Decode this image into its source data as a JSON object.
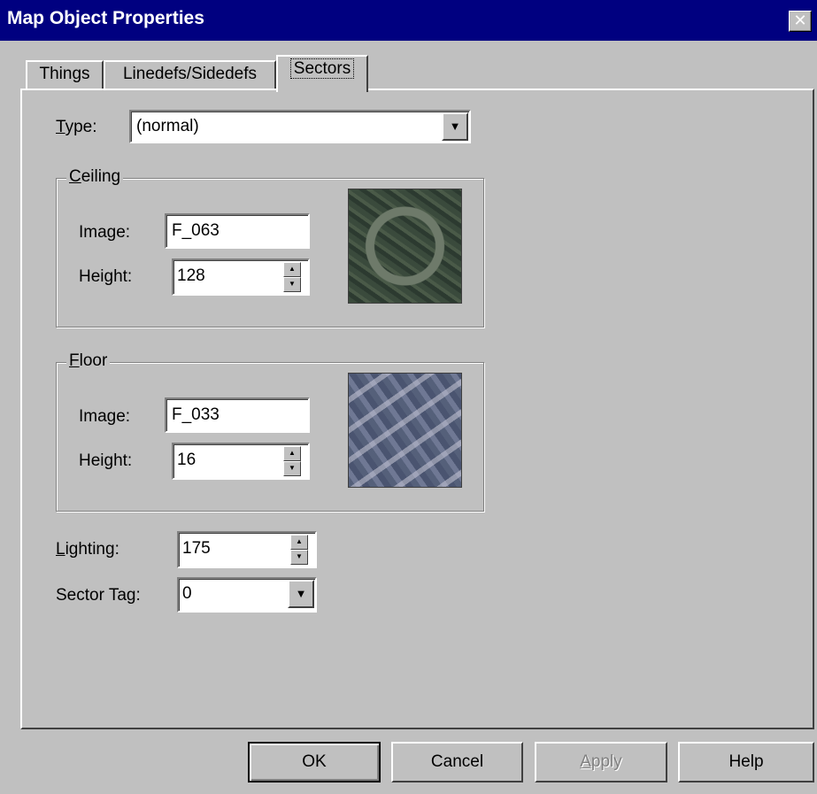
{
  "window": {
    "title": "Map Object Properties",
    "close_glyph": "✕"
  },
  "tabs": [
    {
      "label": "Things",
      "active": false
    },
    {
      "label": "Linedefs/Sidedefs",
      "active": false
    },
    {
      "label": "Sectors",
      "active": true
    }
  ],
  "type_field": {
    "label_mnemonic": "T",
    "label_rest": "ype:",
    "value": "(normal)"
  },
  "ceiling": {
    "group_mnemonic": "C",
    "group_rest": "eiling",
    "image_label": "Image:",
    "image_value": "F_063",
    "height_label": "Height:",
    "height_value": "128",
    "texture_icon": "ceiling-texture-preview"
  },
  "floor": {
    "group_mnemonic": "F",
    "group_rest": "loor",
    "image_label": "Image:",
    "image_value": "F_033",
    "height_label": "Height:",
    "height_value": "16",
    "texture_icon": "floor-texture-preview"
  },
  "lighting": {
    "label_mnemonic": "L",
    "label_rest": "ighting:",
    "value": "175"
  },
  "sector_tag": {
    "label": "Sector Tag:",
    "value": "0"
  },
  "buttons": {
    "ok": "OK",
    "cancel": "Cancel",
    "apply_mnemonic": "A",
    "apply_rest": "pply",
    "help": "Help"
  },
  "glyphs": {
    "dropdown": "▼",
    "spin_up": "▲",
    "spin_down": "▼"
  },
  "colors": {
    "titlebar": "#000080",
    "face": "#c0c0c0",
    "disabled_text": "#808080"
  }
}
